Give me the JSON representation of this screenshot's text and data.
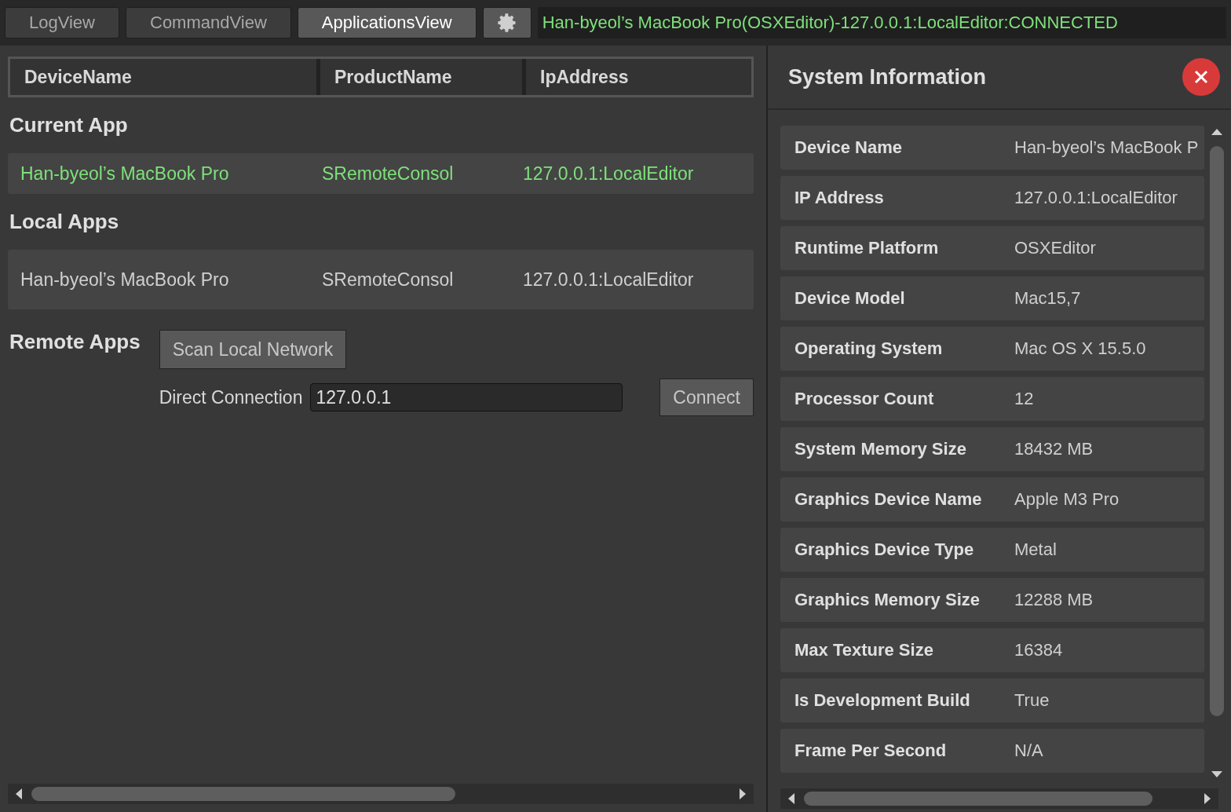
{
  "tabs": [
    {
      "label": "LogView",
      "selected": false
    },
    {
      "label": "CommandView",
      "selected": false
    },
    {
      "label": "ApplicationsView",
      "selected": true
    }
  ],
  "status": "Han-byeol’s MacBook Pro(OSXEditor)-127.0.0.1:LocalEditor:CONNECTED",
  "table": {
    "columns": [
      "DeviceName",
      "ProductName",
      "IpAddress"
    ]
  },
  "sections": [
    {
      "title": "Current App",
      "rows": [
        {
          "device": "Han-byeol’s MacBook Pro",
          "product": "SRemoteConsol",
          "ip": "127.0.0.1:LocalEditor",
          "current": true
        }
      ]
    },
    {
      "title": "Local Apps",
      "rows": [
        {
          "device": "Han-byeol’s MacBook Pro",
          "product": "SRemoteConsol",
          "ip": "127.0.0.1:LocalEditor",
          "current": false
        }
      ]
    }
  ],
  "remote": {
    "title": "Remote Apps",
    "scan_button": "Scan Local Network",
    "direct_label": "Direct Connection",
    "address": "127.0.0.1",
    "connect_button": "Connect"
  },
  "system_info": {
    "title": "System Information",
    "rows": [
      {
        "label": "Device Name",
        "value": "Han-byeol’s MacBook P"
      },
      {
        "label": "IP Address",
        "value": "127.0.0.1:LocalEditor"
      },
      {
        "label": "Runtime Platform",
        "value": "OSXEditor"
      },
      {
        "label": "Device Model",
        "value": "Mac15,7"
      },
      {
        "label": "Operating System",
        "value": "Mac OS X 15.5.0"
      },
      {
        "label": "Processor Count",
        "value": "12"
      },
      {
        "label": "System Memory Size",
        "value": "18432 MB"
      },
      {
        "label": "Graphics Device Name",
        "value": "Apple M3 Pro"
      },
      {
        "label": "Graphics Device Type",
        "value": "Metal"
      },
      {
        "label": "Graphics Memory Size",
        "value": "12288 MB"
      },
      {
        "label": "Max Texture Size",
        "value": "16384"
      },
      {
        "label": "Is Development Build",
        "value": "True"
      },
      {
        "label": "Frame Per Second",
        "value": "N/A"
      }
    ]
  }
}
